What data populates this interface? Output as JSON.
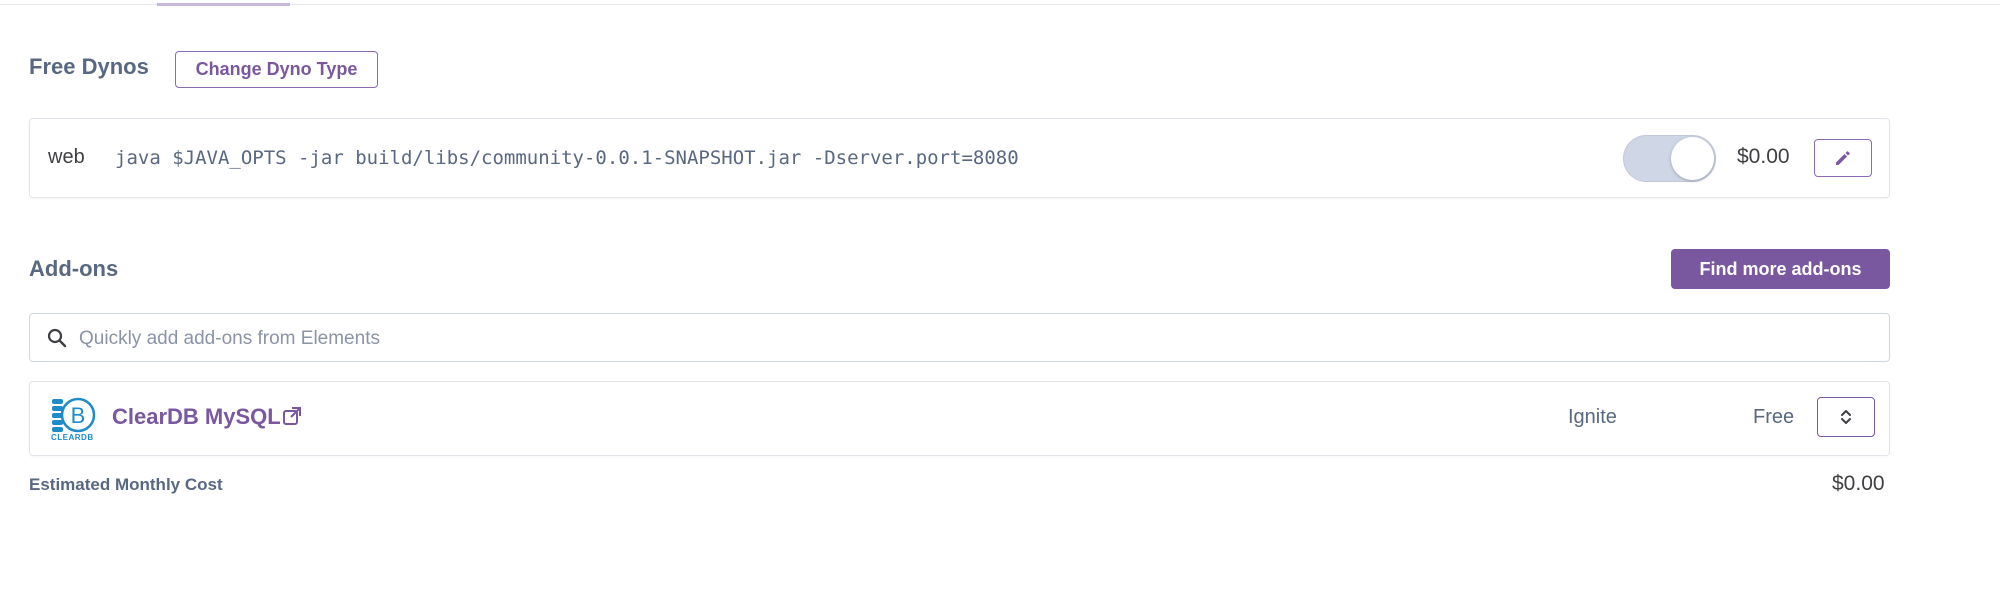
{
  "colors": {
    "accent": "#79589f",
    "muted_text": "#596881",
    "border": "#e1e4e8",
    "toggle_bg": "#cfd7e6",
    "logo_blue": "#1f8bc9"
  },
  "dynos": {
    "title": "Free Dynos",
    "change_type_label": "Change Dyno Type",
    "items": [
      {
        "type": "web",
        "command": "java $JAVA_OPTS -jar build/libs/community-0.0.1-SNAPSHOT.jar -Dserver.port=8080",
        "enabled": true,
        "cost": "$0.00",
        "edit_icon": "pencil-icon"
      }
    ]
  },
  "addons": {
    "title": "Add-ons",
    "find_more_label": "Find more add-ons",
    "search": {
      "placeholder": "Quickly add add-ons from Elements",
      "value": "",
      "icon": "search-icon"
    },
    "items": [
      {
        "logo_icon": "cleardb-logo-icon",
        "logo_text": "CLEARDB",
        "name": "ClearDB MySQL",
        "external_icon": "external-link-icon",
        "plan": "Ignite",
        "price": "Free",
        "menu_icon": "chevron-up-down-icon"
      }
    ]
  },
  "summary": {
    "label": "Estimated Monthly Cost",
    "value": "$0.00"
  }
}
